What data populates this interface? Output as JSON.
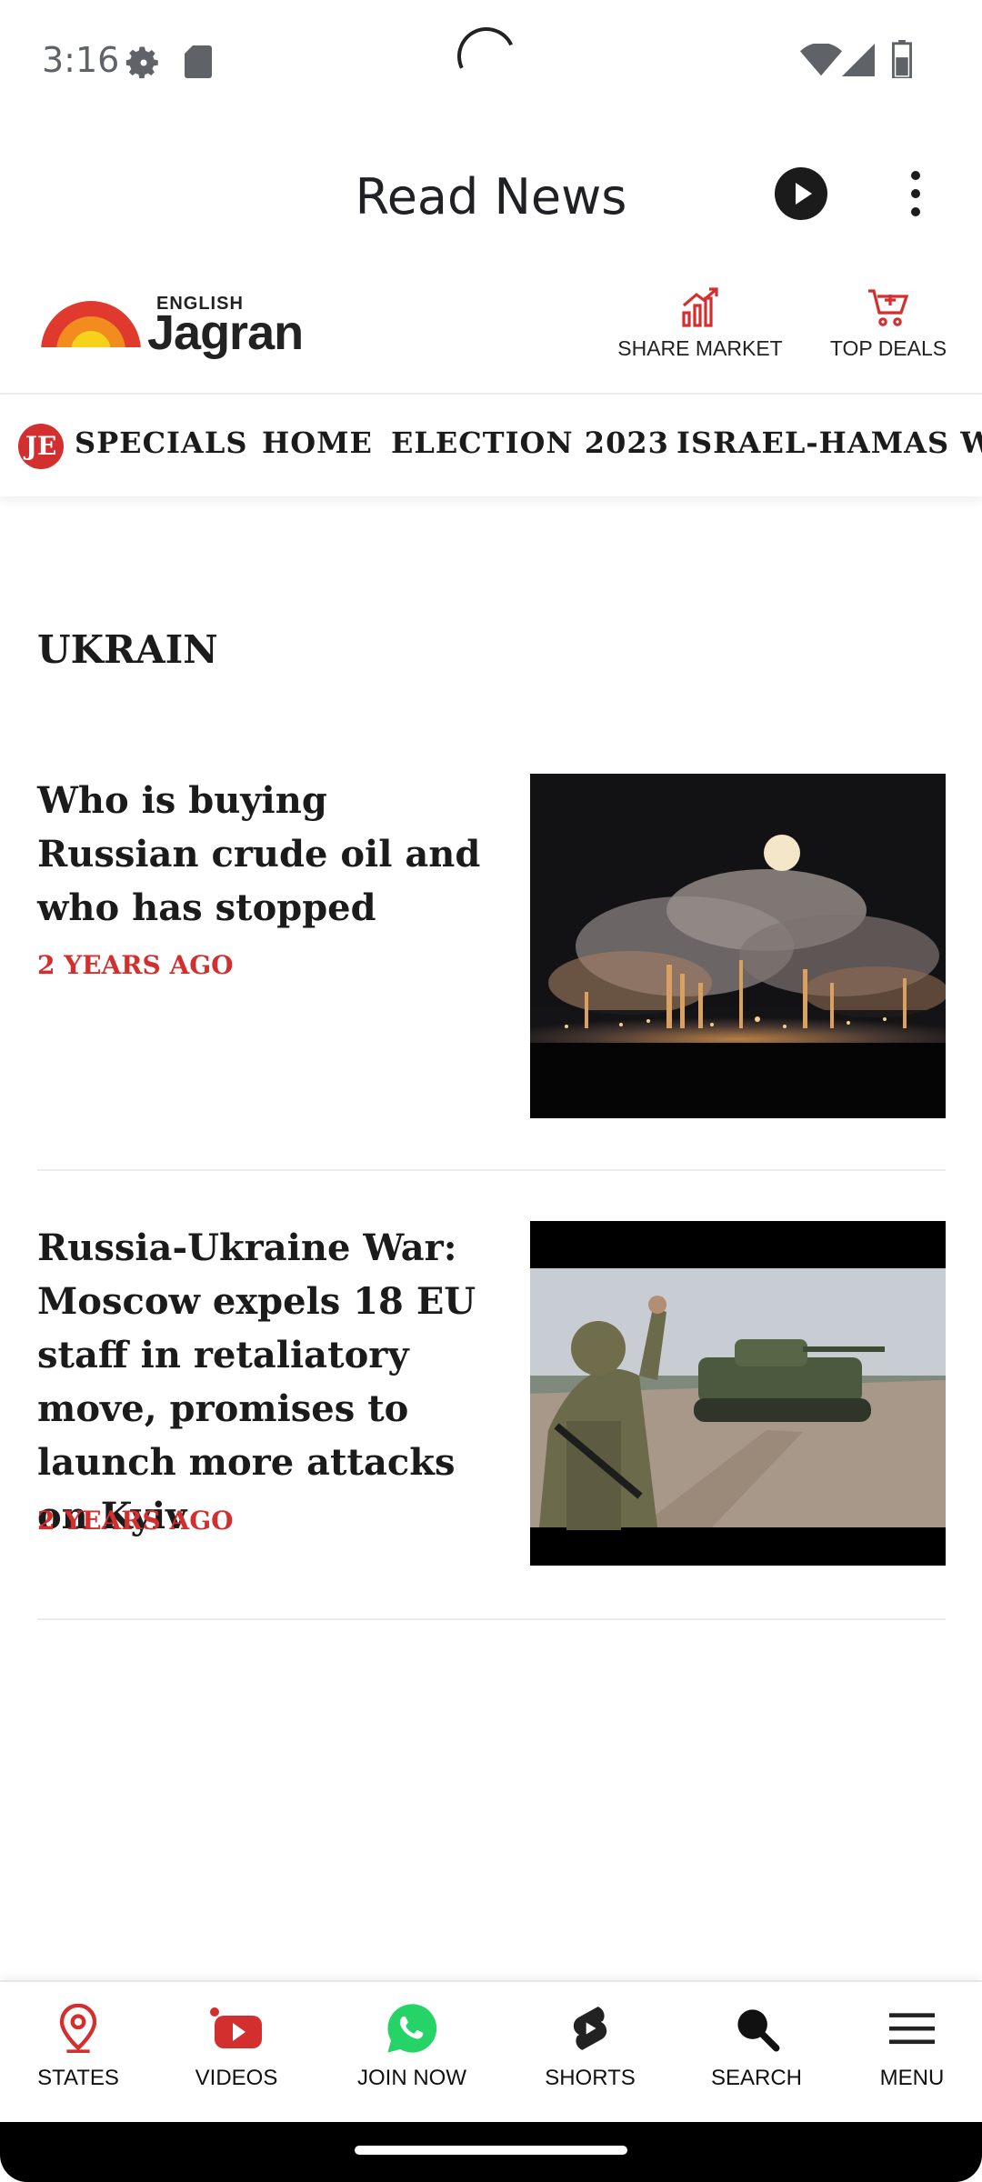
{
  "status_bar": {
    "time": "3:16"
  },
  "app_bar": {
    "title": "Read News"
  },
  "header": {
    "logo_sub": "ENGLISH",
    "logo_main": "Jagran",
    "share_market": "SHARE MARKET",
    "top_deals": "TOP DEALS"
  },
  "nav": {
    "badge": "JE",
    "items": [
      "SPECIALS",
      "HOME",
      "ELECTION 2023",
      "ISRAEL-HAMAS W"
    ]
  },
  "section": {
    "title": "UKRAIN"
  },
  "articles": [
    {
      "title": "Who is buying Russian crude oil and who has stopped",
      "time": "2 YEARS AGO"
    },
    {
      "title": "Russia-Ukraine War: Moscow expels 18 EU staff in retaliatory move, promises to launch more attacks on Kyiv",
      "time": "2 YEARS AGO"
    }
  ],
  "bottom_nav": {
    "states": "STATES",
    "videos": "VIDEOS",
    "join_now": "JOIN NOW",
    "shorts": "SHORTS",
    "search": "SEARCH",
    "menu": "MENU"
  },
  "colors": {
    "accent": "#d32f2f",
    "whatsapp": "#25d366",
    "text": "#1b1b1b"
  }
}
